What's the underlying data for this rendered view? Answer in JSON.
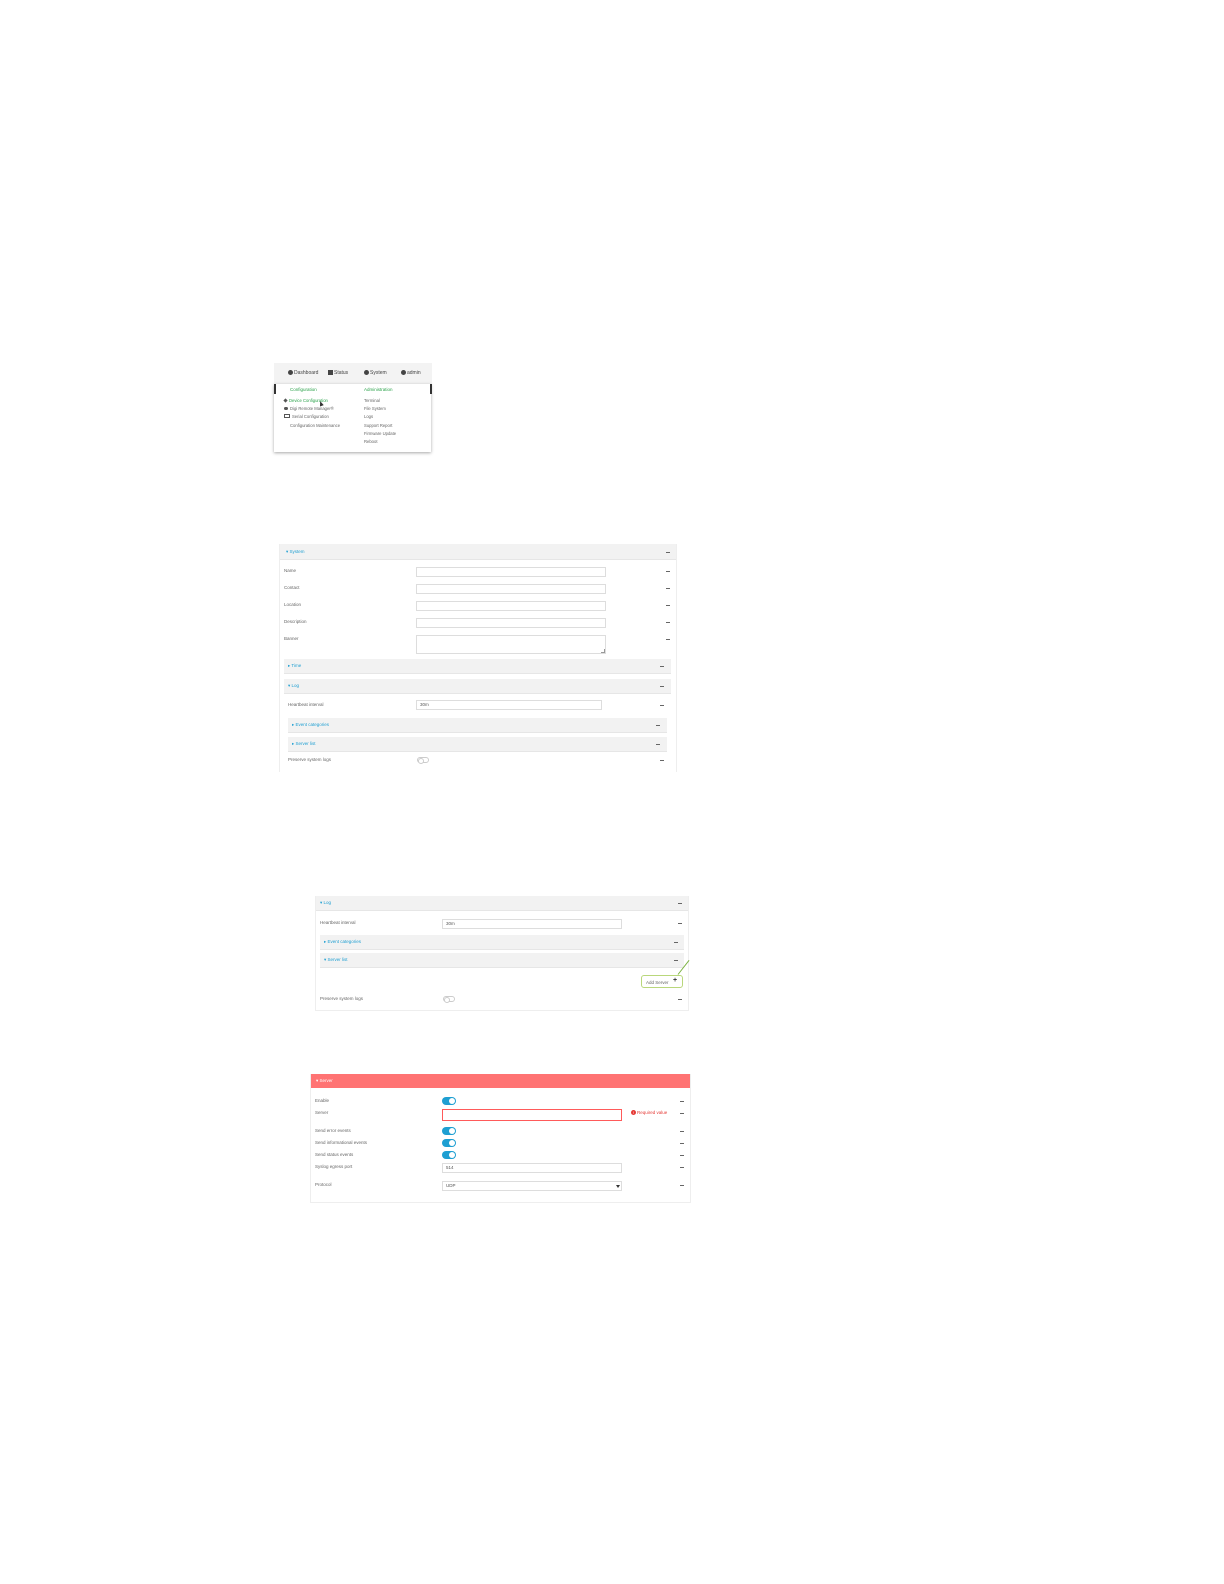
{
  "menu_shot": {
    "nav": {
      "dashboard": "Dashboard",
      "status": "Status",
      "system": "System",
      "user": "admin"
    },
    "configuration": {
      "heading": "Configuration",
      "items": [
        "Device Configuration",
        "Digi Remote Manager®",
        "Serial Configuration",
        "Configuration Maintenance"
      ]
    },
    "administration": {
      "heading": "Administration",
      "items": [
        "Terminal",
        "File System",
        "Logs",
        "Support Report",
        "Firmware Update",
        "Reboot"
      ]
    }
  },
  "system_shot": {
    "section_title": "▾ System",
    "fields": {
      "name": "Name",
      "contact": "Contact",
      "location": "Location",
      "description": "Description",
      "banner": "Banner"
    },
    "time_section": "▸ Time",
    "log_section": "▾ Log",
    "heartbeat_label": "Heartbeat interval",
    "heartbeat_value": "30m",
    "event_categories": "▸ Event categories",
    "server_list": "▸ Server list",
    "preserve_label": "Preserve system logs"
  },
  "log_shot": {
    "log_section": "▾ Log",
    "heartbeat_label": "Heartbeat interval",
    "heartbeat_value": "30m",
    "event_categories": "▸ Event categories",
    "server_list": "▾ Server list",
    "add_server": "Add Server",
    "preserve_label": "Preserve system logs"
  },
  "server_shot": {
    "section_title": "▾ Server",
    "enable_label": "Enable",
    "server_label": "Server",
    "required_text": "Required value",
    "send_error_label": "Send error events",
    "send_info_label": "Send informational events",
    "send_status_label": "Send status events",
    "syslog_port_label": "Syslog egress port",
    "syslog_port_value": "514",
    "protocol_label": "Protocol",
    "protocol_value": "UDP"
  }
}
